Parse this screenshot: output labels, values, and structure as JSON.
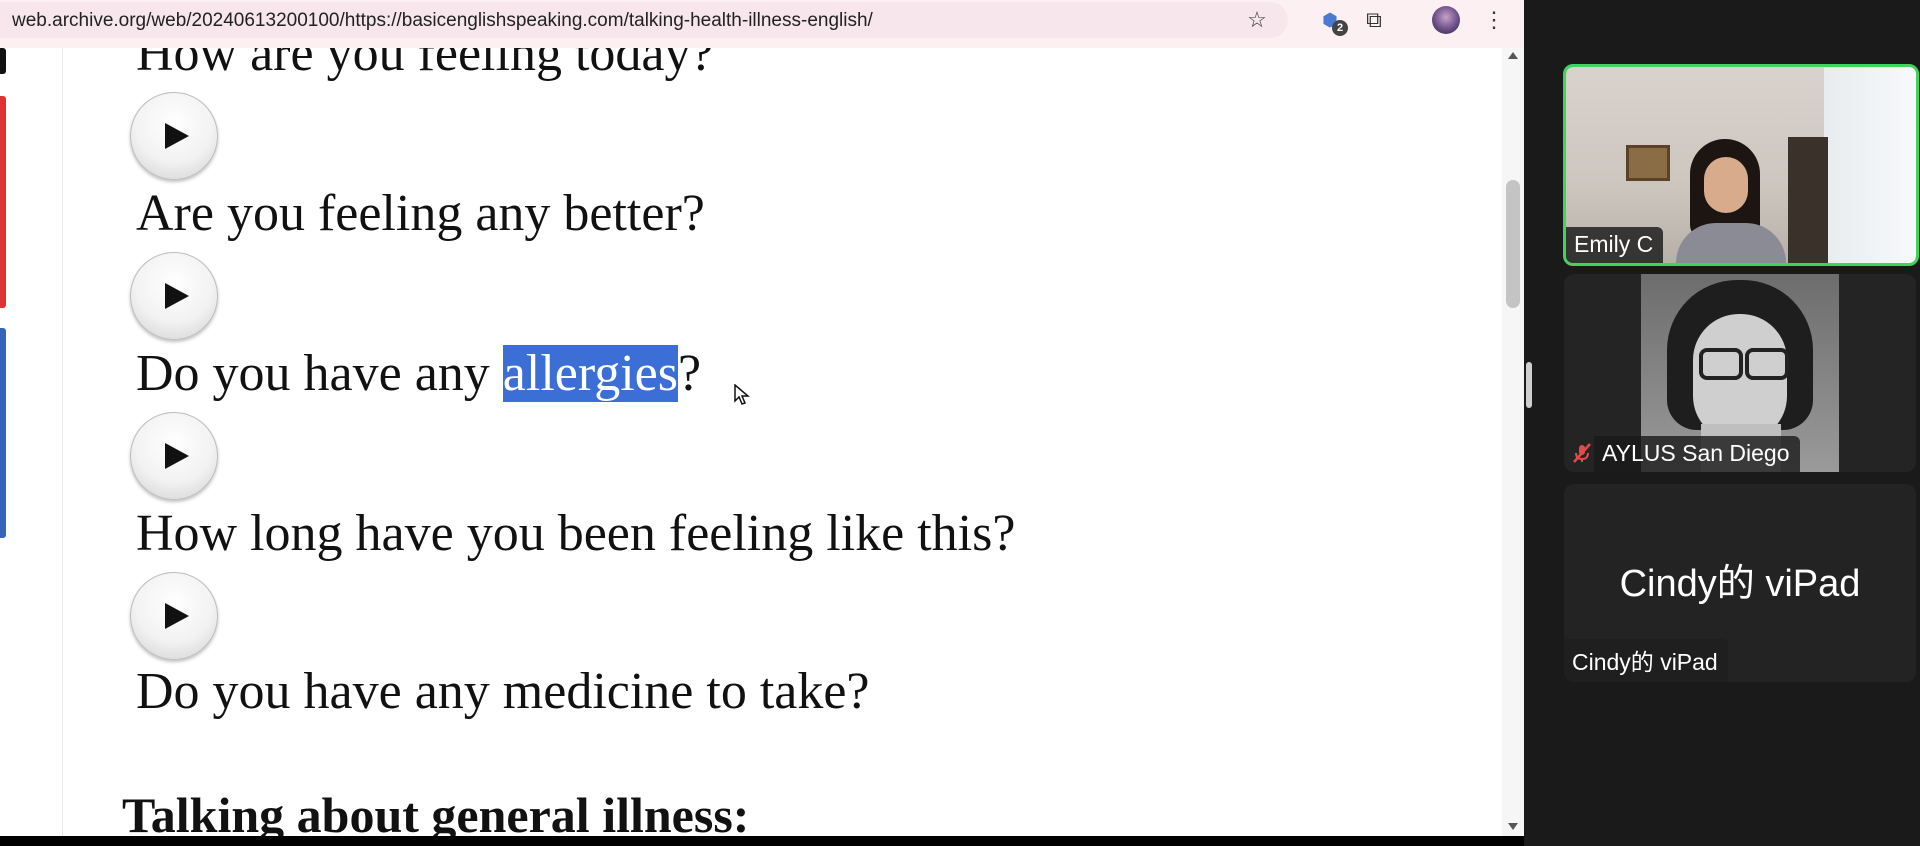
{
  "browser": {
    "url": "web.archive.org/web/20240613200100/https://basicenglishspeaking.com/talking-health-illness-english/",
    "extension_badge": "2"
  },
  "content": {
    "phrases": [
      "How are you feeling today?",
      "Are you feeling any better?",
      "Do you have any ",
      "How long have you been feeling like this?",
      "Do you have any medicine to take?"
    ],
    "selected_word": "allergies",
    "after_selection": "?",
    "section_heading": "Talking about general illness:"
  },
  "meeting": {
    "participants": [
      {
        "name": "Emily C",
        "speaking": true
      },
      {
        "name": "AYLUS San Diego",
        "muted": true
      },
      {
        "name": "Cindy的 viPad",
        "display": "Cindy的 viPad"
      }
    ]
  },
  "colors": {
    "selection": "#3b6fd6",
    "speaking_border": "#3fd45a",
    "muted_icon": "#e24b4b"
  }
}
